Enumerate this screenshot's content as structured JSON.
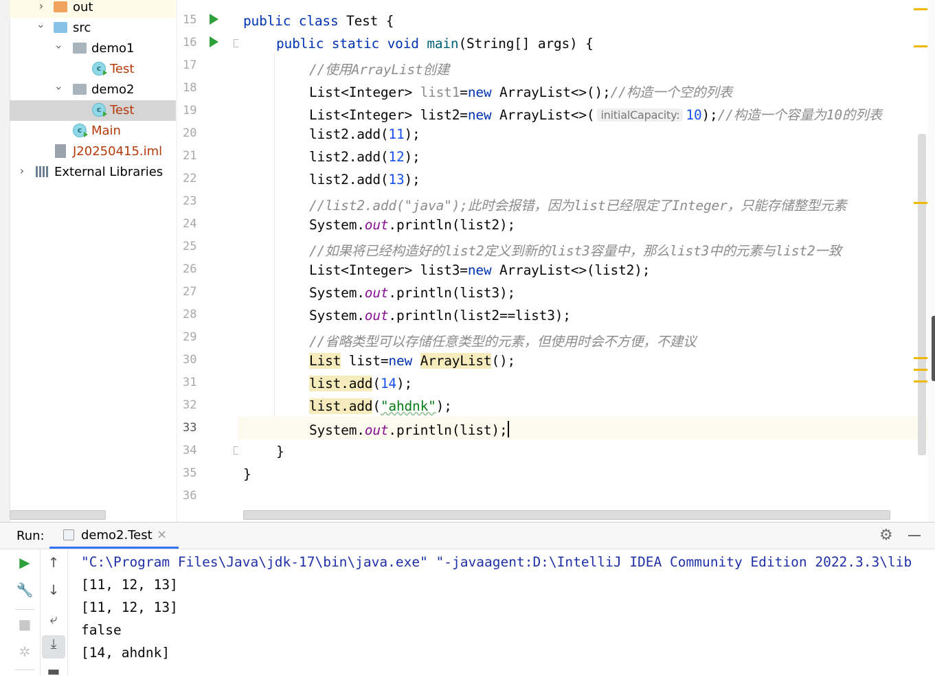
{
  "project_tree": {
    "items": [
      {
        "label": "out",
        "kind": "folder-orange"
      },
      {
        "label": "src",
        "kind": "folder-blue"
      },
      {
        "label": "demo1",
        "kind": "package"
      },
      {
        "label": "Test",
        "kind": "class"
      },
      {
        "label": "demo2",
        "kind": "package"
      },
      {
        "label": "Test",
        "kind": "class",
        "selected": true
      },
      {
        "label": "Main",
        "kind": "class"
      },
      {
        "label": "J20250415.iml",
        "kind": "iml-file"
      },
      {
        "label": "External Libraries",
        "kind": "libraries"
      }
    ]
  },
  "editor": {
    "line_numbers": [
      "15",
      "16",
      "17",
      "18",
      "19",
      "20",
      "21",
      "22",
      "23",
      "24",
      "25",
      "26",
      "27",
      "28",
      "29",
      "30",
      "31",
      "32",
      "33",
      "34",
      "35",
      "36"
    ],
    "current_line": "33",
    "code": {
      "l15": {
        "kw1": "public",
        "kw2": "class",
        "rest": "Test {"
      },
      "l16": {
        "kw1": "public",
        "kw2": "static",
        "kw3": "void",
        "fn": "main",
        "rest": "(String[] args) {"
      },
      "l17": {
        "comment": "//使用ArrayList创建"
      },
      "l18": {
        "a": "List<Integer> ",
        "var": "list1",
        "b": "=",
        "kw": "new",
        "c": " ArrayList<>();",
        "comment": "//构造一个空的列表"
      },
      "l19": {
        "a": "List<Integer> list2=",
        "kw": "new",
        "c": " ArrayList<>(",
        "hint": "initialCapacity:",
        "num": "10",
        "d": ");",
        "comment": "//构造一个容量为10的列表"
      },
      "l20": {
        "a": "list2.add(",
        "num": "11",
        "b": ");"
      },
      "l21": {
        "a": "list2.add(",
        "num": "12",
        "b": ");"
      },
      "l22": {
        "a": "list2.add(",
        "num": "13",
        "b": ");"
      },
      "l23": {
        "comment": "//list2.add(\"java\");此时会报错，因为list已经限定了Integer，只能存储整型元素"
      },
      "l24": {
        "a": "System.",
        "fld": "out",
        "b": ".println(list2);"
      },
      "l25": {
        "comment": "//如果将已经构造好的list2定义到新的list3容量中，那么list3中的元素与list2一致"
      },
      "l26": {
        "a": "List<Integer> list3=",
        "kw": "new",
        "b": " ArrayList<>(list2);"
      },
      "l27": {
        "a": "System.",
        "fld": "out",
        "b": ".println(list3);"
      },
      "l28": {
        "a": "System.",
        "fld": "out",
        "b": ".println(list2==list3);"
      },
      "l29": {
        "comment": "//省略类型可以存储任意类型的元素，但使用时会不方便，不建议"
      },
      "l30": {
        "w1": "List",
        "a": " list=",
        "kw": "new",
        "sp": " ",
        "w2": "ArrayList",
        "b": "();"
      },
      "l31": {
        "w": "list.add",
        "a": "(",
        "num": "14",
        "b": ");"
      },
      "l32": {
        "w": "list.add",
        "a": "(",
        "str": "\"ahdnk\"",
        "b": ");"
      },
      "l33": {
        "a": "System.",
        "fld": "out",
        "b": ".println(list);"
      },
      "l34": {
        "a": "}"
      },
      "l35": {
        "a": "}"
      }
    }
  },
  "run_panel": {
    "label": "Run:",
    "tab_label": "demo2.Test",
    "tab_close": "×",
    "console_lines": [
      "\"C:\\Program Files\\Java\\jdk-17\\bin\\java.exe\" \"-javaagent:D:\\IntelliJ IDEA Community Edition 2022.3.3\\lib",
      "[11, 12, 13]",
      "[11, 12, 13]",
      "false",
      "[14, ahdnk]"
    ]
  },
  "colors": {
    "keyword": "#0033b3",
    "number": "#1750eb",
    "string": "#067d17",
    "comment": "#8c8c8c",
    "static_field": "#871094",
    "run_green": "#2fa03a",
    "selection": "#d5d5d5"
  }
}
